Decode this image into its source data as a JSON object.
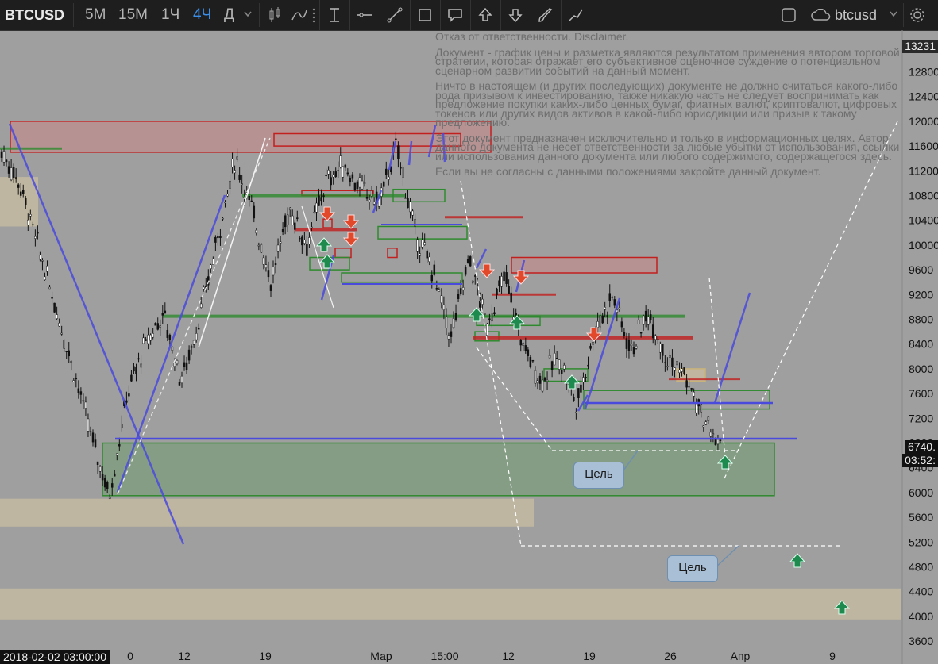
{
  "toolbar": {
    "symbol": "BTCUSD",
    "intervals": [
      "5M",
      "15M",
      "1Ч",
      "4Ч",
      "Д"
    ],
    "active_interval": "4Ч",
    "account": "btcusd",
    "accent": "#3b8fe8"
  },
  "drawing_tools": [
    "cursor-icon",
    "text-cursor-icon",
    "horizontal-line-icon",
    "trend-line-icon",
    "rectangle-icon",
    "callout-icon",
    "arrow-up-icon",
    "arrow-down-icon",
    "brush-icon",
    "path-icon"
  ],
  "disclaimer": {
    "title": "Отказ от ответственности. Disclaimer.",
    "paragraphs": [
      "Документ - график цены и разметка являются результатом применения автором торговой стратегии, которая отражает его субъективное оценочное суждение о потенциальном сценарном развитии событий на данный момент.",
      "Ничто в настоящем (и других последующих) документе не должно считаться какого-либо рода призывом к инвестированию, также никакую часть не следует воспринимать как предложение покупки каких-либо ценных бумаг, фиатных валют, криптовалют, цифровых токенов или других видов активов в какой-либо юрисдикции или призыв к такому предложению.",
      "Этот документ предназначен исключительно и только в информационных целях. Автор данного документа не несет ответственности за любые убытки от использования, ссылки или использования данного документа или любого содержимого, содержащегося здесь.",
      "Если вы не согласны с данными положениями закройте данный документ."
    ]
  },
  "targets": [
    "Цель",
    "Цель"
  ],
  "current_price": "6740.",
  "countdown": "03:52:",
  "top_price": "13231",
  "crosshair_date": "2018-02-02 03:00:00",
  "chart_data": {
    "type": "line",
    "title": "",
    "ylim": [
      3500,
      13300
    ],
    "y_ticks": [
      "12800",
      "12400",
      "12000",
      "11600",
      "11200",
      "10800",
      "10400",
      "10000",
      "9600",
      "9200",
      "8800",
      "8400",
      "8000",
      "7600",
      "7200",
      "6800",
      "6400",
      "6000",
      "5600",
      "5200",
      "4800",
      "4400",
      "4000",
      "3600"
    ],
    "x_ticks": [
      "0",
      "12",
      "19",
      "Мар",
      "15:00",
      "12",
      "19",
      "26",
      "Апр",
      "9"
    ],
    "series": [
      {
        "values": [
          11500,
          11000,
          10000,
          9000,
          8000,
          6900,
          5950,
          7600,
          8400,
          8900,
          7800,
          8800,
          10100,
          11400,
          10500,
          9400,
          10600,
          10000,
          11000,
          11300,
          10900,
          10700,
          11600,
          10200,
          9600,
          8500,
          9800,
          8700,
          9500,
          8400,
          7800,
          8200,
          7400,
          8600,
          9200,
          8300,
          8900,
          8200,
          7900,
          7200,
          6740
        ]
      }
    ],
    "zones": {
      "resistance_red": [
        [
          12000,
          11500
        ],
        [
          11800,
          11600
        ],
        [
          9800,
          9550
        ]
      ],
      "support_green": [
        [
          6800,
          5950
        ],
        [
          7650,
          7350
        ]
      ],
      "tan_bands": [
        [
          5900,
          5450
        ],
        [
          4450,
          3950
        ]
      ]
    },
    "colors": {
      "candle": "#111111",
      "trend": "#4a4adc",
      "resistance": "#c21f1f",
      "support": "#2f8a2f",
      "tan": "#d8c8a3",
      "arrow_up": "#1e8a4e",
      "arrow_down": "#e2492b"
    }
  }
}
